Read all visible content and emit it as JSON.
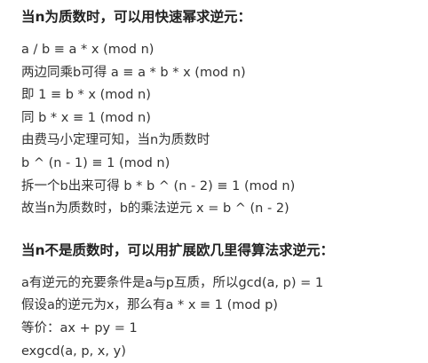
{
  "section1": {
    "heading": "当n为质数时，可以用快速幂求逆元：",
    "lines": [
      "a / b ≡ a * x (mod n)",
      "两边同乘b可得 a ≡ a * b * x (mod n)",
      "即 1 ≡ b * x (mod n)",
      "同 b * x ≡ 1 (mod n)",
      "由费马小定理可知，当n为质数时",
      "b ^ (n - 1) ≡ 1 (mod n)",
      "拆一个b出来可得 b * b ^ (n - 2) ≡ 1 (mod n)",
      "故当n为质数时，b的乘法逆元 x = b ^ (n - 2)"
    ]
  },
  "section2": {
    "heading": "当n不是质数时，可以用扩展欧几里得算法求逆元：",
    "lines": [
      "a有逆元的充要条件是a与p互质，所以gcd(a, p) = 1",
      "假设a的逆元为x，那么有a * x ≡ 1 (mod p)",
      "等价：ax + py = 1",
      "exgcd(a, p, x, y)"
    ]
  }
}
